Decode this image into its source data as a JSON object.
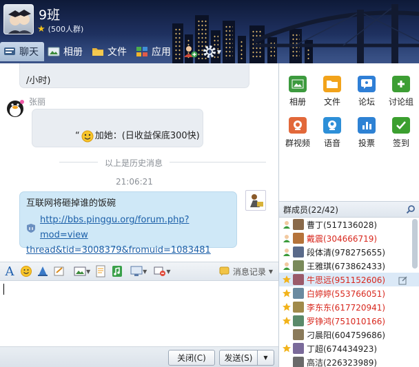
{
  "header": {
    "title": "9班",
    "subtitle": "(500人群)",
    "tabs": [
      {
        "label": "聊天"
      },
      {
        "label": "相册"
      },
      {
        "label": "文件"
      },
      {
        "label": "应用"
      }
    ]
  },
  "chat": {
    "msg1_tail": "/小时)",
    "sender2": "张丽",
    "msg2_quote_mark": "“",
    "msg2_text": "加她：(日收益保底300快)",
    "history_divider": "以上是历史消息",
    "timestamp": "21:06:21",
    "msg3_title": "互联网将砸掉谁的饭碗",
    "msg3_link_line1": "http://bbs.pinggu.org/forum.php?mod=view",
    "msg3_link_line2": "thread&tid=3008379&fromuid=1083481"
  },
  "input_toolbar": {
    "history_label": "消息记录"
  },
  "bottom": {
    "close_label": "关闭(C)",
    "send_label": "发送(S)"
  },
  "apps": [
    {
      "label": "相册",
      "color": "#3c9a3e",
      "icon": "picture-icon"
    },
    {
      "label": "文件",
      "color": "#f2a31b",
      "icon": "folder-icon"
    },
    {
      "label": "论坛",
      "color": "#2f7fd6",
      "icon": "forum-icon"
    },
    {
      "label": "讨论组",
      "color": "#3d9e34",
      "icon": "discussion-icon"
    },
    {
      "label": "群视频",
      "color": "#e2683a",
      "icon": "video-icon"
    },
    {
      "label": "语音",
      "color": "#2d8fd8",
      "icon": "voice-icon"
    },
    {
      "label": "投票",
      "color": "#2e82d4",
      "icon": "vote-icon"
    },
    {
      "label": "签到",
      "color": "#3b9f2f",
      "icon": "checkin-icon"
    }
  ],
  "members": {
    "header": "群成员(22/42)",
    "list": [
      {
        "name": "曹丁(517136028)",
        "color": "#222222",
        "role": "owner"
      },
      {
        "name": "戴震(304666719)",
        "color": "#d8271d",
        "role": "owner"
      },
      {
        "name": "段体清(978275655)",
        "color": "#222222",
        "role": "owner"
      },
      {
        "name": "王雅琪(673862433)",
        "color": "#222222",
        "role": "owner"
      },
      {
        "name": "牛思远(951152606)",
        "color": "#d8271d",
        "role": "admin"
      },
      {
        "name": "白婷婷(553766051)",
        "color": "#d8271d",
        "role": "admin"
      },
      {
        "name": "李东东(617720941)",
        "color": "#d8271d",
        "role": "admin"
      },
      {
        "name": "罗铮鸿(751010166)",
        "color": "#d8271d",
        "role": "admin"
      },
      {
        "name": "刁晨阳(604759686)",
        "color": "#222222",
        "role": "member"
      },
      {
        "name": "丁超(674434923)",
        "color": "#222222",
        "role": "admin"
      },
      {
        "name": "高洁(226323989)",
        "color": "#222222",
        "role": "member"
      }
    ]
  }
}
